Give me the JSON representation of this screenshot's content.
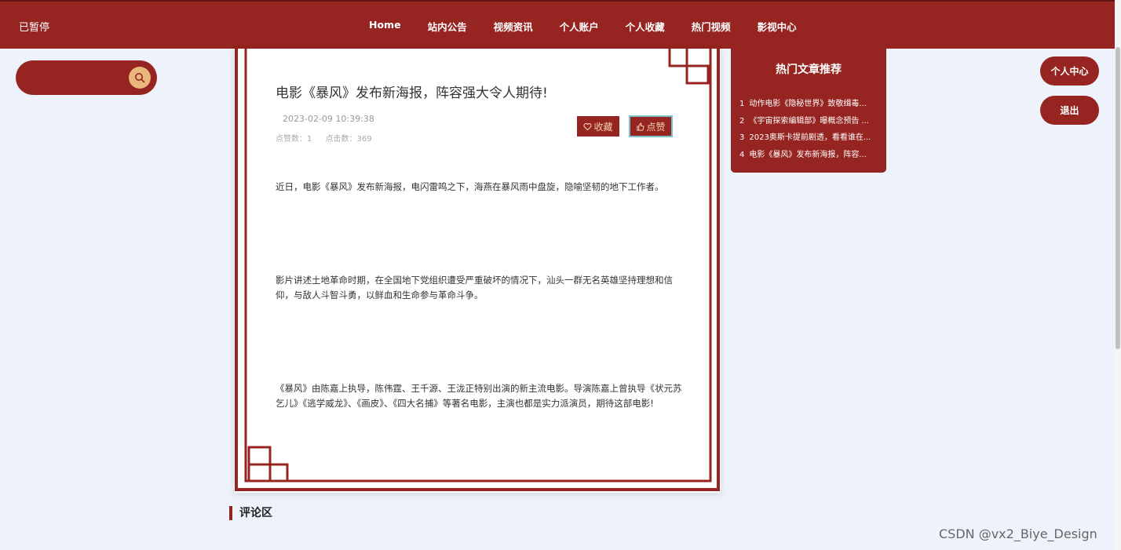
{
  "status": {
    "paused": "已暂停"
  },
  "nav": [
    "Home",
    "站内公告",
    "视频资讯",
    "个人账户",
    "个人收藏",
    "热门视频",
    "影视中心"
  ],
  "search": {
    "placeholder": "",
    "icon": "search-icon"
  },
  "article": {
    "title": "电影《暴风》发布新海报，阵容强大令人期待!",
    "date": "2023-02-09 10:39:38",
    "likes": "点赞数：1",
    "clicks": "点击数：369",
    "favorite_label": "收藏",
    "like_label": "点赞",
    "paragraphs": [
      "近日，电影《暴风》发布新海报，电闪雷鸣之下，海燕在暴风雨中盘旋，隐喻坚韧的地下工作者。",
      "影片讲述土地革命时期，在全国地下党组织遭受严重破坏的情况下，汕头一群无名英雄坚持理想和信仰，与敌人斗智斗勇，以鲜血和生命参与革命斗争。",
      "《暴风》由陈嘉上执导，陈伟霆、王千源、王泷正特别出演的新主流电影。导演陈嘉上曾执导《状元苏乞儿》《逃学威龙》、《画皮》、《四大名捕》等著名电影，主演也都是实力派演员，期待这部电影!"
    ]
  },
  "hot": {
    "title": "热门文章推荐",
    "items": [
      {
        "num": "1",
        "text": "动作电影《隐秘世界》致敬缉毒..."
      },
      {
        "num": "2",
        "text": "《宇宙探索编辑部》曝概念预告 ..."
      },
      {
        "num": "3",
        "text": "2023奥斯卡提前剧透，看看谁在..."
      },
      {
        "num": "4",
        "text": "电影《暴风》发布新海报，阵容..."
      }
    ]
  },
  "user": {
    "center": "个人中心",
    "logout": "退出"
  },
  "comments": {
    "title": "评论区"
  },
  "watermark": "CSDN @vx2_Biye_Design",
  "colors": {
    "brand": "#962420",
    "background": "#eef3fb",
    "accent": "#e9b77c"
  }
}
